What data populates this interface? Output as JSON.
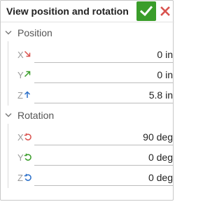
{
  "dialog": {
    "title": "View position and rotation",
    "ok_color": "#3a9d2a",
    "cancel_color": "#d9534f"
  },
  "position": {
    "header": "Position",
    "rows": [
      {
        "axis": "X",
        "icon": "arrow-down-right-icon",
        "icon_color": "#d9534f",
        "value": "0 in"
      },
      {
        "axis": "Y",
        "icon": "arrow-up-right-icon",
        "icon_color": "#3a9d2a",
        "value": "0 in"
      },
      {
        "axis": "Z",
        "icon": "arrow-up-icon",
        "icon_color": "#2a6fc9",
        "value": "5.8 in"
      }
    ]
  },
  "rotation": {
    "header": "Rotation",
    "rows": [
      {
        "axis": "X",
        "icon": "rotate-icon",
        "icon_color": "#d9534f",
        "value": "90 deg"
      },
      {
        "axis": "Y",
        "icon": "rotate-icon",
        "icon_color": "#3a9d2a",
        "value": "0 deg"
      },
      {
        "axis": "Z",
        "icon": "rotate-icon",
        "icon_color": "#2a6fc9",
        "value": "0 deg"
      }
    ]
  }
}
